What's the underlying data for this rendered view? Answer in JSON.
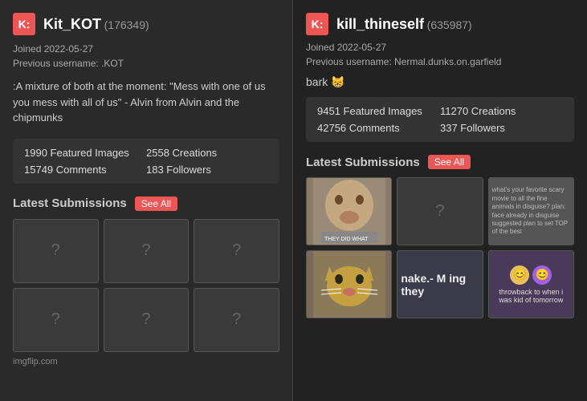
{
  "left": {
    "logo": "K:",
    "username": "Kit_KOT",
    "user_id": "(176349)",
    "joined_label": "Joined 2022-05-27",
    "prev_username_label": "Previous username: .KOT",
    "bio": ":A mixture of both at the moment: \"Mess with one of us you mess with all of us\" - Alvin from Alvin and the chipmunks",
    "stats": {
      "featured_images": "1990 Featured Images",
      "creations": "2558 Creations",
      "comments": "15749 Comments",
      "followers": "183 Followers"
    },
    "latest_submissions_label": "Latest Submissions",
    "see_all_label": "See All",
    "site_label": "imgflip.com",
    "thumbs": [
      "?",
      "?",
      "?",
      "?",
      "?",
      "?"
    ]
  },
  "right": {
    "logo": "K:",
    "username": "kill_thineself",
    "user_id": "(635987)",
    "joined_label": "Joined 2022-05-27",
    "prev_username_label": "Previous username: Nermal.dunks.on.garfield",
    "bark_text": "bark 😸",
    "stats": {
      "featured_images": "9451 Featured Images",
      "creations": "11270 Creations",
      "comments": "42756 Comments",
      "followers": "337 Followers"
    },
    "latest_submissions_label": "Latest Submissions",
    "see_all_label": "See All",
    "thumb_texts": {
      "face": "",
      "question": "?",
      "text_content": "what's your favorite scary movie to all the fine animals in disguise?\nplan: face already in disguise\nsuggested plan to set TOP of the best",
      "cat": "",
      "make_text": "nake.- M\ning they",
      "throwback_text": "throwback to when i was kid of tomorrow"
    }
  }
}
